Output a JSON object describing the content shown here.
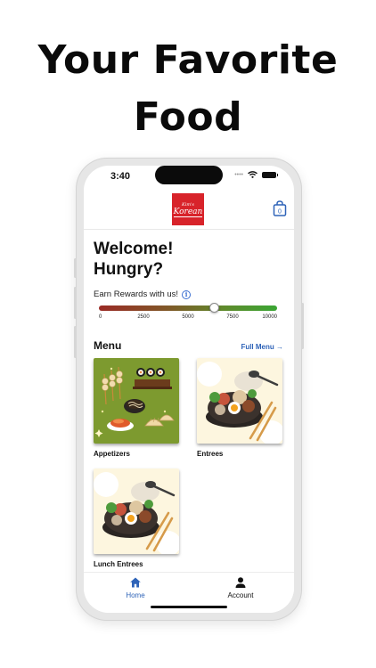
{
  "headline": {
    "line1": "Your Favorite",
    "line2": "Food"
  },
  "status_bar": {
    "time": "3:40",
    "signal_dots": "••••"
  },
  "header": {
    "logo_small": "Kim's",
    "logo_big": "Korean"
  },
  "welcome": {
    "line1": "Welcome!",
    "line2": "Hungry?"
  },
  "rewards": {
    "label": "Earn Rewards with us!",
    "info_symbol": "i",
    "value": 6450,
    "min": 0,
    "max": 10000,
    "ticks": [
      "0",
      "2500",
      "5000",
      "7500",
      "10000"
    ]
  },
  "menu": {
    "title": "Menu",
    "full_menu_link": "Full Menu →",
    "items": [
      {
        "label": "Appetizers"
      },
      {
        "label": "Entrees"
      },
      {
        "label": "Lunch Entrees"
      }
    ]
  },
  "tabs": [
    {
      "label": "Home",
      "active": true
    },
    {
      "label": "Account",
      "active": false
    }
  ],
  "colors": {
    "accent": "#2e63b8",
    "logo_red": "#d8232a",
    "appetizer_bg": "#7d9a2f",
    "entree_bg": "#fbeec5"
  }
}
